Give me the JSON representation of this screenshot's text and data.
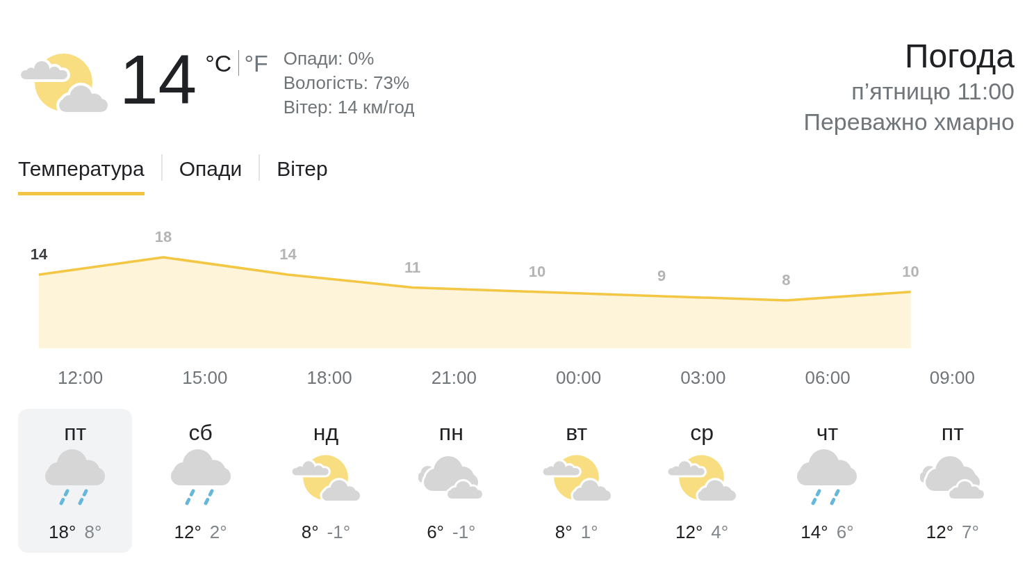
{
  "current": {
    "kind": "partly_cloudy",
    "temperature": "14",
    "units": [
      {
        "label": "°C",
        "selected": true
      },
      {
        "label": "°F",
        "selected": false
      }
    ],
    "details": [
      "Опади: 0%",
      "Вологість: 73%",
      "Вітер: 14 км/год"
    ]
  },
  "title": "Погода",
  "time": "п’ятницю 11:00",
  "condition": "Переважно хмарно",
  "tabs": [
    {
      "label": "Температура",
      "selected": true
    },
    {
      "label": "Опади",
      "selected": false
    },
    {
      "label": "Вітер",
      "selected": false
    }
  ],
  "chart": {
    "chart_data": {
      "type": "area",
      "categories": [
        null,
        "12:00",
        null,
        null,
        "15:00",
        null,
        null,
        "18:00",
        null,
        null,
        "21:00",
        null,
        null,
        "00:00",
        null,
        null,
        "03:00",
        null,
        null,
        "06:00",
        null,
        null,
        "09:00",
        null
      ],
      "series": [
        {
          "color": "#f3c744",
          "values": [
            14,
            null,
            null,
            18,
            null,
            null,
            14,
            null,
            null,
            11,
            null,
            null,
            10,
            null,
            null,
            9,
            null,
            null,
            8,
            null,
            null,
            10,
            null,
            null
          ]
        }
      ],
      "data_labels": true
    }
  },
  "days": [
    {
      "day": "пт",
      "kind": "rain",
      "high": "18°",
      "low": "8°",
      "selected": true
    },
    {
      "day": "сб",
      "kind": "rain",
      "high": "12°",
      "low": "2°",
      "selected": false
    },
    {
      "day": "нд",
      "kind": "partly_cloudy",
      "high": "8°",
      "low": "-1°",
      "selected": false
    },
    {
      "day": "пн",
      "kind": "cloudy",
      "high": "6°",
      "low": "-1°",
      "selected": false
    },
    {
      "day": "вт",
      "kind": "partly_cloudy",
      "high": "8°",
      "low": "1°",
      "selected": false
    },
    {
      "day": "ср",
      "kind": "partly_cloudy",
      "high": "12°",
      "low": "4°",
      "selected": false
    },
    {
      "day": "чт",
      "kind": "rain",
      "high": "14°",
      "low": "6°",
      "selected": false
    },
    {
      "day": "пт",
      "kind": "cloudy",
      "high": "12°",
      "low": "7°",
      "selected": false
    }
  ]
}
